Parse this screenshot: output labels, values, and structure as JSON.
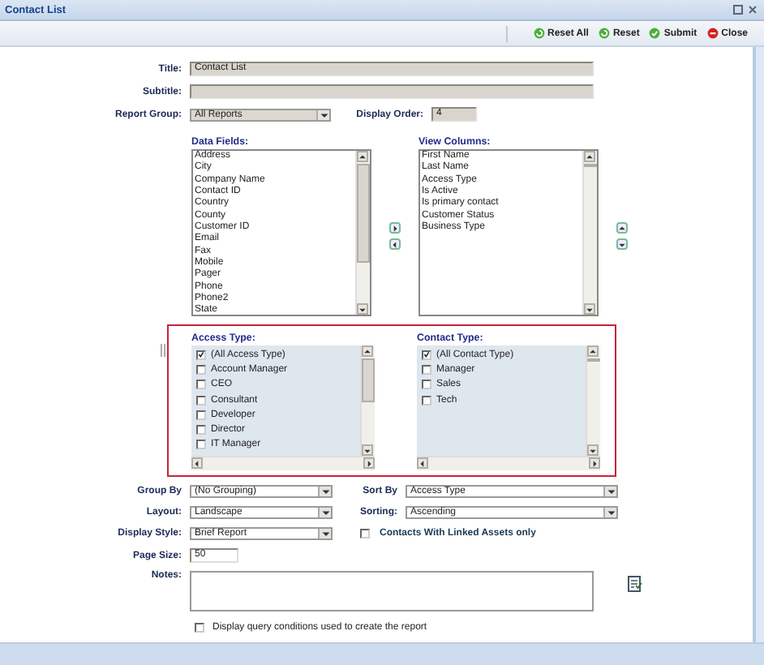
{
  "window": {
    "title": "Contact List"
  },
  "toolbar": [
    {
      "label": "Reset All",
      "kind": "reset"
    },
    {
      "label": "Reset",
      "kind": "reset"
    },
    {
      "label": "Submit",
      "kind": "submit"
    },
    {
      "label": "Close",
      "kind": "close"
    }
  ],
  "title": {
    "label": "Title:",
    "value": "Contact List"
  },
  "subtitle": {
    "label": "Subtitle:"
  },
  "report_group": {
    "label": "Report Group:",
    "value": "All Reports"
  },
  "display_order": {
    "label": "Display Order:",
    "value": "4"
  },
  "data_fields": {
    "label": "Data Fields:",
    "items": [
      "Address",
      "City",
      "Company Name",
      "Contact ID",
      "Country",
      "County",
      "Customer ID",
      "Email",
      "Fax",
      "Mobile",
      "Pager",
      "Phone",
      "Phone2",
      "State"
    ]
  },
  "view_columns": {
    "label": "View Columns:",
    "items": [
      "First Name",
      "Last Name",
      "Access Type",
      "Is Active",
      "Is primary contact",
      "Customer Status",
      "Business Type"
    ]
  },
  "access_type": {
    "label": "Access Type:",
    "options": [
      {
        "label": "(All Access Type)",
        "checked": true
      },
      {
        "label": "Account Manager",
        "checked": false
      },
      {
        "label": "CEO",
        "checked": false
      },
      {
        "label": "Consultant",
        "checked": false
      },
      {
        "label": "Developer",
        "checked": false
      },
      {
        "label": "Director",
        "checked": false
      },
      {
        "label": "IT Manager",
        "checked": false
      }
    ]
  },
  "contact_type": {
    "label": "Contact Type:",
    "options": [
      {
        "label": "(All Contact Type)",
        "checked": true
      },
      {
        "label": "Manager",
        "checked": false
      },
      {
        "label": "Sales",
        "checked": false
      },
      {
        "label": "Tech",
        "checked": false
      }
    ]
  },
  "group_by": {
    "label": "Group By",
    "value": "(No Grouping)"
  },
  "sort_by": {
    "label": "Sort By",
    "value": "Access Type"
  },
  "layout": {
    "label": "Layout:",
    "value": "Landscape"
  },
  "sorting": {
    "label": "Sorting:",
    "value": "Ascending"
  },
  "display_style": {
    "label": "Display Style:",
    "value": "Brief Report"
  },
  "linked_assets": {
    "label": "Contacts With Linked Assets only",
    "checked": false
  },
  "page_size": {
    "label": "Page Size:",
    "value": "50"
  },
  "notes": {
    "label": "Notes:"
  },
  "show_conditions": {
    "label": "Display query conditions used to create the report",
    "checked": false
  }
}
